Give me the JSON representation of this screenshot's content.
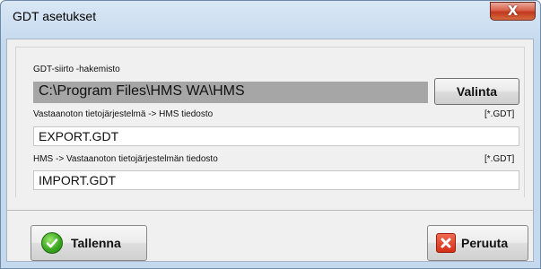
{
  "window": {
    "title": "GDT asetukset",
    "close_glyph": "X"
  },
  "gdt_directory": {
    "label": "GDT-siirto -hakemisto",
    "value": "C:\\Program Files\\HMS WA\\HMS",
    "browse_label": "Valinta"
  },
  "export_file": {
    "label": "Vastaanoton tietojärjestelmä -> HMS tiedosto",
    "filter": "[*.GDT]",
    "value": "EXPORT.GDT"
  },
  "import_file": {
    "label": "HMS -> Vastaanoton tietojärjestelmän tiedosto",
    "filter": "[*.GDT]",
    "value": "IMPORT.GDT"
  },
  "buttons": {
    "save_label": "Tallenna",
    "save_icon": "check-icon",
    "cancel_label": "Peruuta",
    "cancel_icon": "cross-icon"
  },
  "colors": {
    "title_bar": "#c5d9ee",
    "close_button": "#c9432a",
    "ok_icon": "#3da824",
    "cancel_icon": "#d42f16",
    "dir_field": "#a6a6a6"
  }
}
